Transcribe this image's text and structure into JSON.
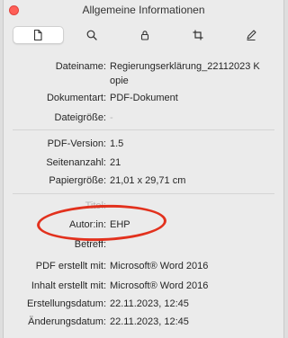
{
  "window": {
    "title": "Allgemeine Informationen"
  },
  "toolbar": {
    "tabs": [
      {
        "icon": "document-icon",
        "active": true
      },
      {
        "icon": "search-icon",
        "active": false
      },
      {
        "icon": "lock-icon",
        "active": false
      },
      {
        "icon": "crop-icon",
        "active": false
      },
      {
        "icon": "pencil-icon",
        "active": false
      }
    ]
  },
  "info": {
    "dateiname_label": "Dateiname:",
    "dateiname_value_line1": "Regierungserklärung_22112023 K",
    "dateiname_value_line2": "opie",
    "dokumentart_label": "Dokumentart:",
    "dokumentart_value": "PDF-Dokument",
    "dateigroesse_label": "Dateigröße:",
    "dateigroesse_value": "-",
    "pdfversion_label": "PDF-Version:",
    "pdfversion_value": "1.5",
    "seitenanzahl_label": "Seitenanzahl:",
    "seitenanzahl_value": "21",
    "papiergroesse_label": "Papiergröße:",
    "papiergroesse_value": "21,01 x 29,71 cm",
    "titel_label": "Titel:",
    "autor_label": "Autor:in:",
    "autor_value": "EHP",
    "betreff_label": "Betreff:",
    "pdf_erstellt_label": "PDF erstellt mit:",
    "pdf_erstellt_value": "Microsoft® Word 2016",
    "inhalt_erstellt_label": "Inhalt erstellt mit:",
    "inhalt_erstellt_value": "Microsoft® Word 2016",
    "erstellungsdatum_label": "Erstellungsdatum:",
    "erstellungsdatum_value": "22.11.2023, 12:45",
    "aenderungsdatum_label": "Änderungsdatum:",
    "aenderungsdatum_value": "22.11.2023, 12:45"
  },
  "colors": {
    "highlight": "#e2311d"
  }
}
